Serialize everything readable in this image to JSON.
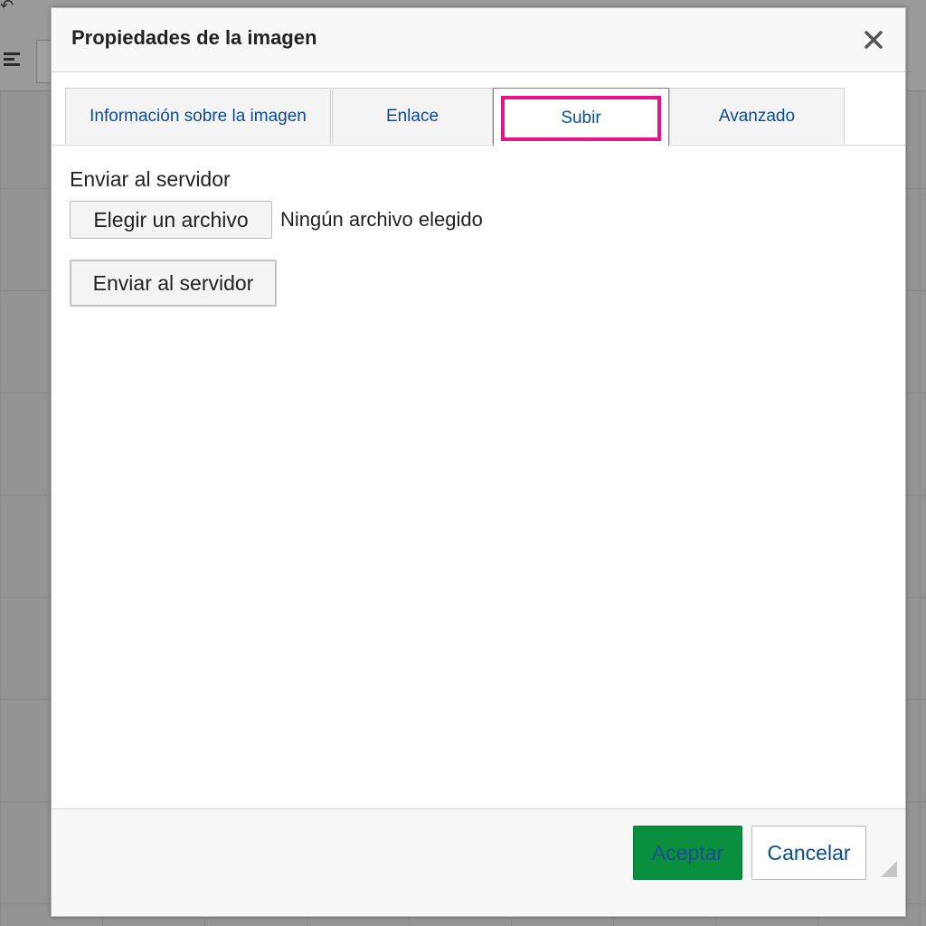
{
  "dialog": {
    "title": "Propiedades de la imagen",
    "close_icon": "close-icon"
  },
  "tabs": [
    {
      "label": "Información sobre la imagen",
      "active": false
    },
    {
      "label": "Enlace",
      "active": false
    },
    {
      "label": "Subir",
      "active": true
    },
    {
      "label": "Avanzado",
      "active": false
    }
  ],
  "upload": {
    "section_label": "Enviar al servidor",
    "choose_file_label": "Elegir un archivo",
    "file_status": "Ningún archivo elegido",
    "send_button_label": "Enviar al servidor"
  },
  "footer": {
    "ok_label": "Aceptar",
    "cancel_label": "Cancelar"
  },
  "colors": {
    "tab_text": "#0b4a9a",
    "active_tab_border": "#2f9ae5",
    "highlight_outline": "#e6148c",
    "ok_button_bg": "#0a8f3f"
  }
}
